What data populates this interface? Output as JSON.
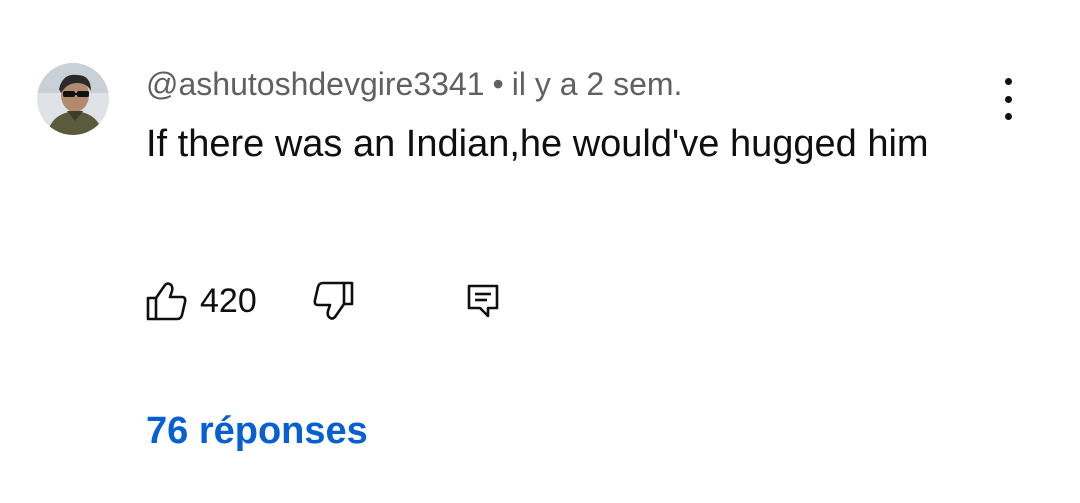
{
  "comment": {
    "author": "@ashutoshdevgire3341",
    "separator": "•",
    "time": "il y a 2 sem.",
    "text": "If there was an Indian,he would've hugged him",
    "like_count": "420",
    "replies_label": "76 réponses"
  },
  "icons": {
    "avatar": "avatar-photo",
    "menu": "more-vert-icon",
    "like": "thumb-up-icon",
    "dislike": "thumb-down-icon",
    "reply": "reply-comment-icon"
  },
  "colors": {
    "text_primary": "#0f0f0f",
    "text_secondary": "#606060",
    "link_blue": "#065fd4",
    "background": "#ffffff"
  }
}
